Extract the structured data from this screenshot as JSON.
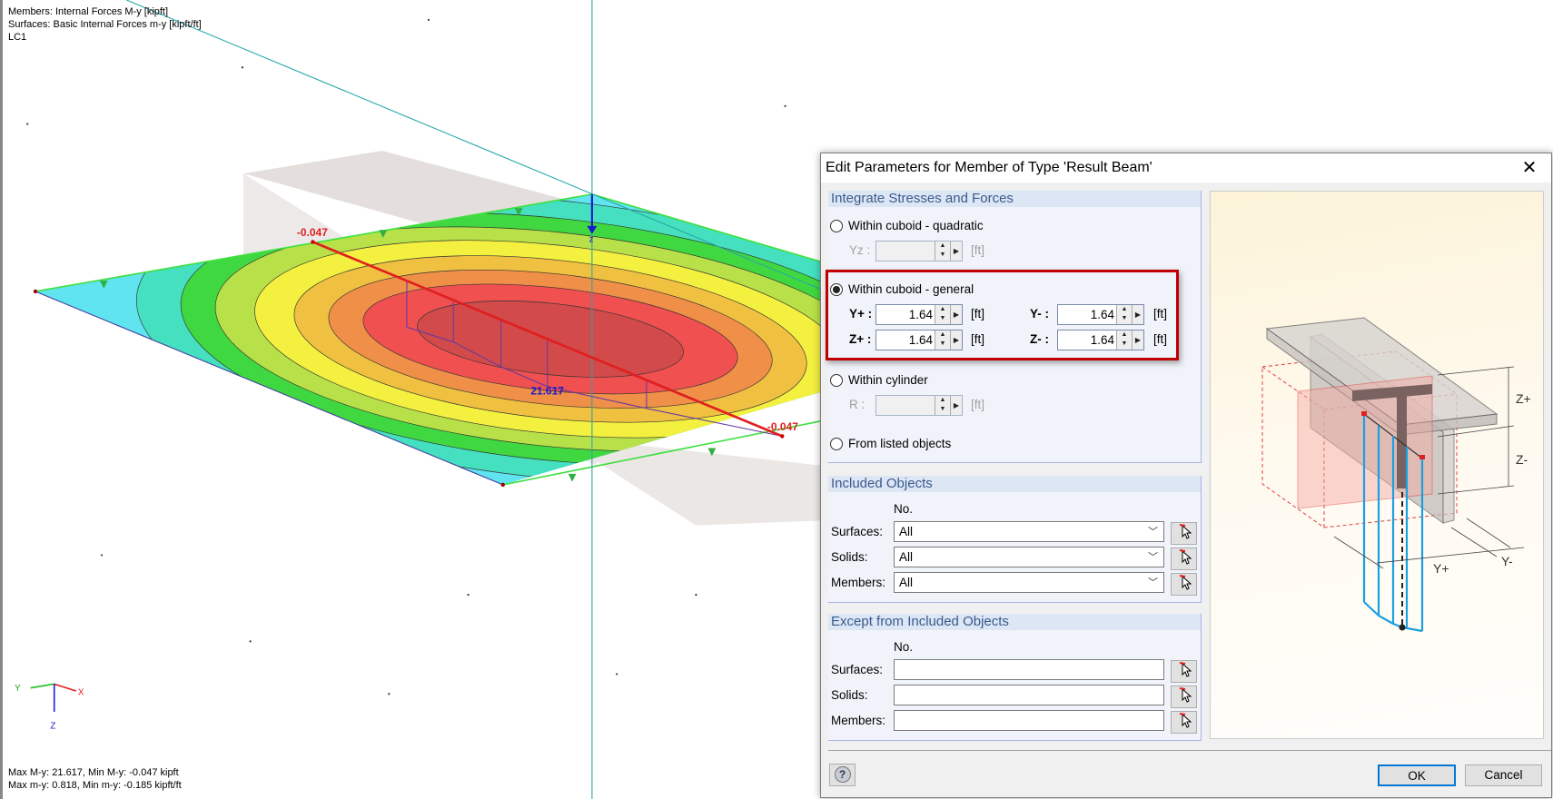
{
  "viewport": {
    "info_lines": [
      "Members: Internal Forces M-y [kipft]",
      "Surfaces: Basic Internal Forces m-y [kipft/ft]",
      "LC1"
    ],
    "summary_lines": [
      "Max M-y: 21.617, Min M-y: -0.047 kipft",
      "Max m-y: 0.818, Min m-y: -0.185 kipft/ft"
    ],
    "result_labels": {
      "start": "-0.047",
      "max": "21.617",
      "end": "-0.047"
    },
    "axis_labels": {
      "x": "X",
      "y": "Y",
      "z": "Z",
      "z_local": "z"
    },
    "colors": {
      "axis_line": "#2aa6a6",
      "member": "#e02020",
      "max_label": "#1a1ad0"
    },
    "contour_colors": [
      "#7070e8",
      "#60e4f0",
      "#44e0c0",
      "#40d840",
      "#b8e048",
      "#f4f040",
      "#f0c040",
      "#f09048",
      "#f05050",
      "#d24a4a"
    ]
  },
  "dialog": {
    "title": "Edit Parameters for Member of Type 'Result Beam'",
    "close_icon": "close-icon",
    "integrate": {
      "header": "Integrate Stresses and Forces",
      "quadratic": {
        "label": "Within cuboid - quadratic",
        "selected": false,
        "yz_label": "Yz :",
        "yz_value": "",
        "unit": "[ft]"
      },
      "general": {
        "label": "Within cuboid - general",
        "selected": true,
        "yplus_label": "Y+ :",
        "yplus_value": "1.64",
        "yminus_label": "Y- :",
        "yminus_value": "1.64",
        "zplus_label": "Z+ :",
        "zplus_value": "1.64",
        "zminus_label": "Z- :",
        "zminus_value": "1.64",
        "unit": "[ft]"
      },
      "cylinder": {
        "label": "Within cylinder",
        "selected": false,
        "r_label": "R :",
        "r_value": "",
        "unit": "[ft]"
      },
      "listed": {
        "label": "From listed objects",
        "selected": false
      }
    },
    "included": {
      "header": "Included Objects",
      "col_header": "No.",
      "rows": [
        {
          "label": "Surfaces:",
          "value": "All"
        },
        {
          "label": "Solids:",
          "value": "All"
        },
        {
          "label": "Members:",
          "value": "All"
        }
      ]
    },
    "except": {
      "header": "Except from Included Objects",
      "col_header": "No.",
      "rows": [
        {
          "label": "Surfaces:",
          "value": ""
        },
        {
          "label": "Solids:",
          "value": ""
        },
        {
          "label": "Members:",
          "value": ""
        }
      ]
    },
    "figure_labels": {
      "zplus": "Z+",
      "zminus": "Z-",
      "yplus": "Y+",
      "yminus": "Y-"
    },
    "buttons": {
      "ok": "OK",
      "cancel": "Cancel"
    }
  }
}
